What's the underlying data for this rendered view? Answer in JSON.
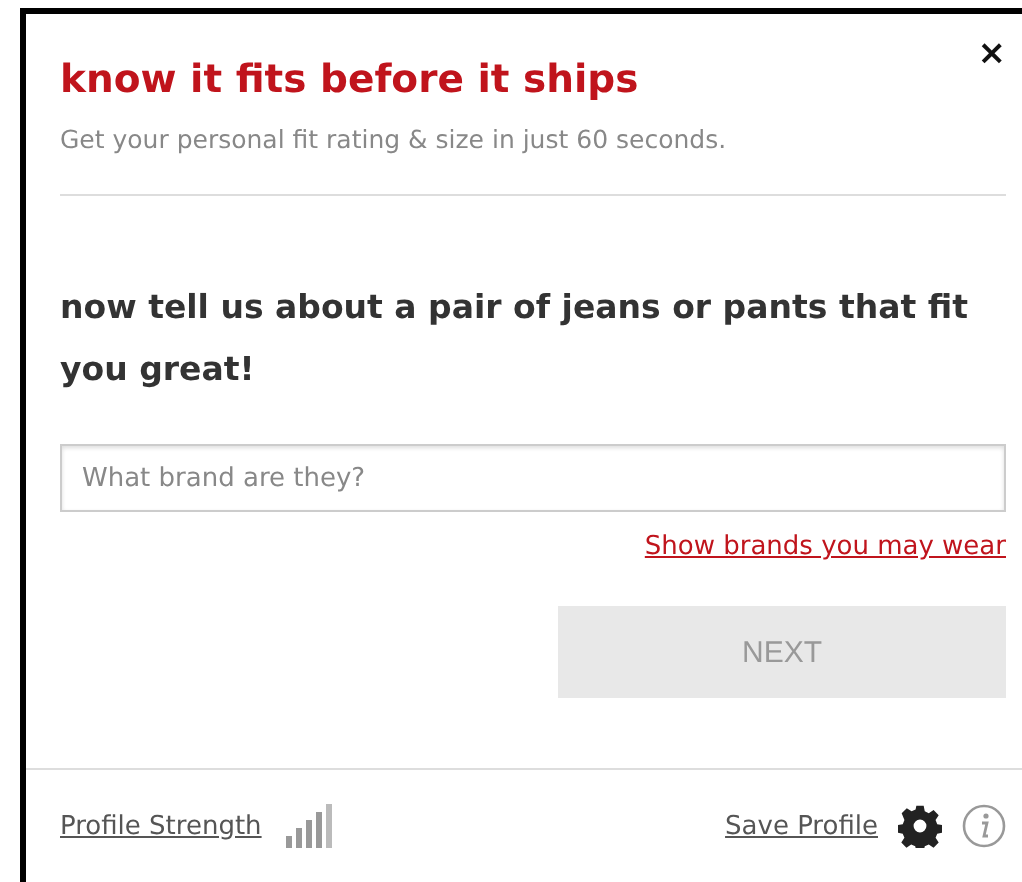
{
  "close": "×",
  "title": "know it fits before it ships",
  "subtitle": "Get your personal fit rating & size in just 60 seconds.",
  "question": "now tell us about a pair of jeans or pants that fit you great!",
  "brand_field": {
    "placeholder": "What brand are they?"
  },
  "brands_link": "Show brands you may wear",
  "next_button": {
    "label": "NEXT",
    "disabled": true
  },
  "footer": {
    "profile_strength": "Profile Strength",
    "save_profile": "Save Profile"
  }
}
